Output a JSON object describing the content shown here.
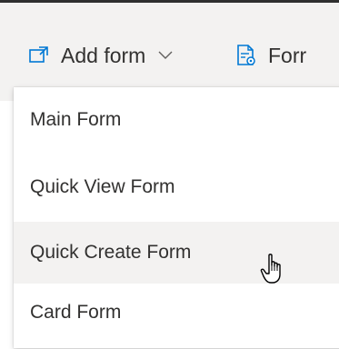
{
  "toolbar": {
    "add_form_label": "Add form",
    "form_label": "Forr",
    "icons": {
      "add_form": "new-window-icon",
      "add_form_chevron": "chevron-down-icon",
      "form": "form-settings-icon"
    }
  },
  "menu": {
    "items": [
      {
        "label": "Main Form"
      },
      {
        "label": "Quick View Form"
      },
      {
        "label": "Quick Create Form",
        "hovered": true
      },
      {
        "label": "Card Form"
      }
    ]
  },
  "cursor": {
    "icon": "hand-pointer-icon"
  },
  "colors": {
    "toolbar_bg": "#f3f2f1",
    "menu_bg": "#ffffff",
    "hover_bg": "#f3f2f1",
    "text": "#323130",
    "accent_blue": "#0078d4"
  }
}
